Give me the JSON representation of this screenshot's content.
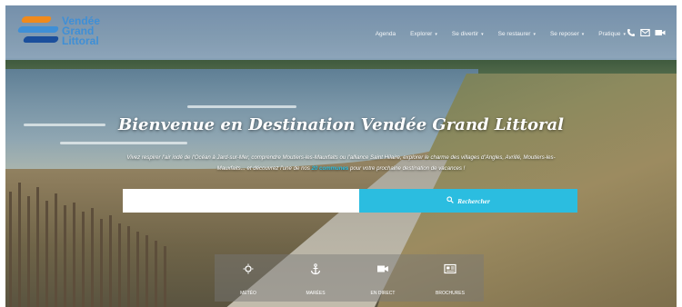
{
  "brand": {
    "logo_lines": [
      "Vendée",
      "Grand",
      "Littoral"
    ],
    "colors": {
      "logo_orange": "#f08a1c",
      "logo_blue": "#1b4f9c",
      "logo_light_blue": "#3f8fd6",
      "accent": "#2bbde0"
    }
  },
  "nav": {
    "items": [
      {
        "label": "Agenda",
        "has_dropdown": false
      },
      {
        "label": "Explorer",
        "has_dropdown": true
      },
      {
        "label": "Se divertir",
        "has_dropdown": true
      },
      {
        "label": "Se restaurer",
        "has_dropdown": true
      },
      {
        "label": "Se reposer",
        "has_dropdown": true
      },
      {
        "label": "Pratique",
        "has_dropdown": true
      }
    ],
    "caret": "▾",
    "icons": [
      "phone-icon",
      "mail-icon",
      "video-icon"
    ]
  },
  "hero": {
    "title": "Bienvenue en Destination Vendée Grand Littoral",
    "subtitle_part1": "Vivez respirer l’air iodé de l’Océan à Jard-sur-Mer, comprendre Moutiers-les-Mauxfaits ou l’alliance Saint Hilaire, explorer le charme des villages d’Angles, Avrillé, Moutiers-les-Mauxfaits... et découvrez l’une de nos ",
    "subtitle_highlight": "20 communes",
    "subtitle_part2": " pour votre prochaine destination de vacances !"
  },
  "search": {
    "placeholder": "",
    "button_label": "Rechercher"
  },
  "quick_links": [
    {
      "label": "MÉTÉO",
      "icon": "sun-icon"
    },
    {
      "label": "MARÉES",
      "icon": "anchor-icon"
    },
    {
      "label": "EN DIRECT",
      "icon": "video-camera-icon"
    },
    {
      "label": "BROCHURES",
      "icon": "newspaper-icon"
    }
  ]
}
